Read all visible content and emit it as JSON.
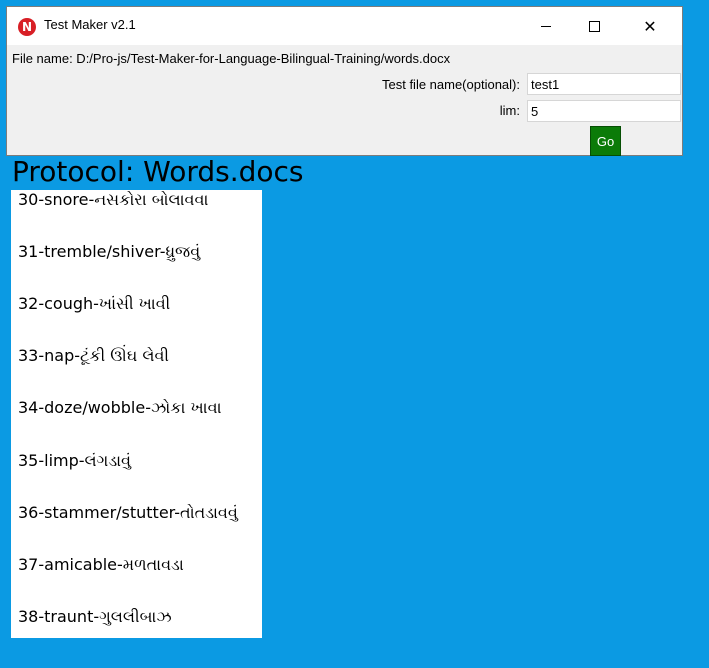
{
  "window": {
    "title": "Test Maker v2.1",
    "icon_letter": "N",
    "controls": {
      "minimize": "minimize",
      "maximize": "maximize",
      "close": "✕"
    }
  },
  "form": {
    "file_label": "File name: D:/Pro-js/Test-Maker-for-Language-Bilingual-Training/words.docx",
    "test_file_label": "Test file name(optional):",
    "test_file_value": "test1",
    "lim_label": "lim:",
    "lim_value": "5",
    "go_label": "Go"
  },
  "protocol": "Protocol: Words.docs",
  "words": [
    "30-snore-નસકોરા બોલાવવા",
    "31-tremble/shiver-ધ્રુજવું",
    "32-cough-ખાંસી ખાવી",
    "33-nap-ટૂંકી ઊંઘ લેવી",
    "34-doze/wobble-ઝોકા ખાવા",
    "35-limp-લંગડાવું",
    "36-stammer/stutter-તોતડાવવું",
    "37-amicable-મળતાવડા",
    "38-traunt-ગુલલીબાઝ"
  ],
  "colors": {
    "desktop": "#0b9ae3",
    "go_button": "#0b7b08",
    "icon": "#d81f26"
  }
}
